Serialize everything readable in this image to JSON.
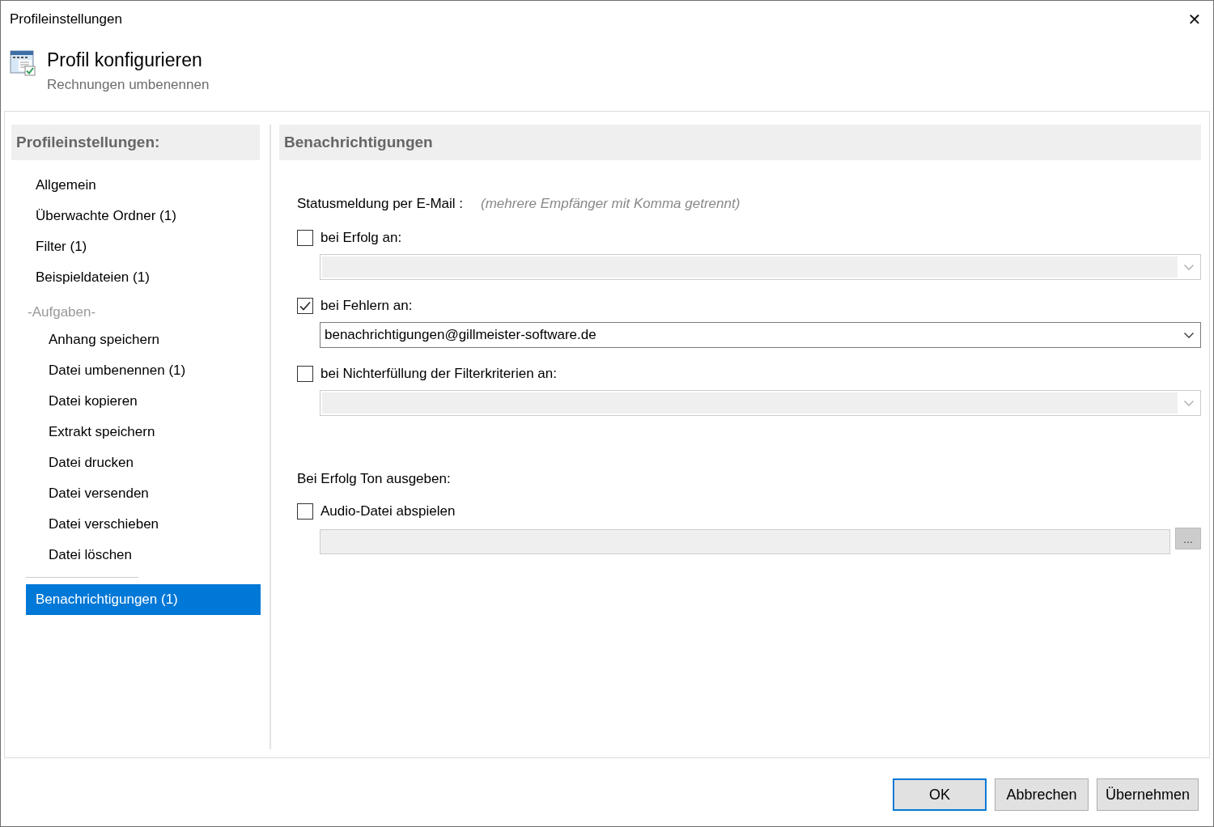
{
  "window": {
    "title": "Profileinstellungen",
    "close_glyph": "✕"
  },
  "header": {
    "title": "Profil konfigurieren",
    "subtitle": "Rechnungen umbenennen"
  },
  "sidebar": {
    "title": "Profileinstellungen:",
    "items": [
      {
        "label": "Allgemein",
        "selected": false
      },
      {
        "label": "Überwachte Ordner (1)",
        "selected": false
      },
      {
        "label": "Filter (1)",
        "selected": false
      },
      {
        "label": "Beispieldateien (1)",
        "selected": false
      },
      {
        "label": "-Aufgaben-",
        "kind": "group",
        "children": [
          {
            "label": "Anhang speichern",
            "selected": false
          },
          {
            "label": "Datei umbenennen (1)",
            "selected": false
          },
          {
            "label": "Datei kopieren",
            "selected": false
          },
          {
            "label": "Extrakt speichern",
            "selected": false
          },
          {
            "label": "Datei drucken",
            "selected": false
          },
          {
            "label": "Datei versenden",
            "selected": false
          },
          {
            "label": "Datei verschieben",
            "selected": false
          },
          {
            "label": "Datei löschen",
            "selected": false
          }
        ]
      },
      {
        "label": "Benachrichtigungen (1)",
        "selected": true
      }
    ]
  },
  "panel": {
    "title": "Benachrichtigungen",
    "email_label": "Statusmeldung per E-Mail :",
    "email_hint": "(mehrere Empfänger mit Komma getrennt)",
    "recipients": [
      {
        "label": "bei Erfolg an:",
        "checked": false,
        "disabled": true
      },
      {
        "label": "bei Fehlern an:",
        "checked": true,
        "disabled": false,
        "value": "benachrichtigungen@gillmeister-software.de"
      },
      {
        "label": "bei Nichterfüllung der Filterkriterien an:",
        "checked": false,
        "disabled": true
      }
    ],
    "sound_label": "Bei Erfolg Ton ausgeben:",
    "audio": {
      "label": "Audio-Datei abspielen",
      "checked": false,
      "disabled": true,
      "browse": "..."
    }
  },
  "buttons": [
    {
      "label": "OK",
      "default": true
    },
    {
      "label": "Abbrechen",
      "default": false
    },
    {
      "label": "Übernehmen",
      "default": false
    }
  ]
}
